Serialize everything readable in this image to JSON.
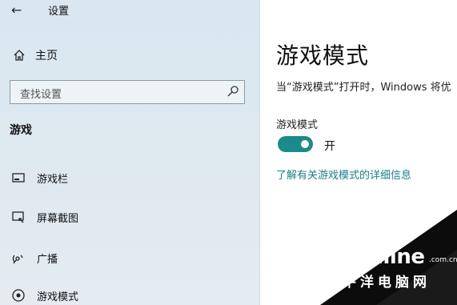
{
  "window": {
    "title": "设置"
  },
  "sidebar": {
    "home_label": "主页",
    "search_placeholder": "查找设置",
    "section_title": "游戏",
    "items": [
      {
        "label": "游戏栏",
        "icon": "game-bar-icon"
      },
      {
        "label": "屏幕截图",
        "icon": "screenshot-icon"
      },
      {
        "label": "广播",
        "icon": "broadcast-icon"
      },
      {
        "label": "游戏模式",
        "icon": "game-mode-icon"
      }
    ]
  },
  "main": {
    "title": "游戏模式",
    "description": "当“游戏模式”打开时，Windows 将优",
    "setting_label": "游戏模式",
    "toggle_state_label": "开",
    "toggle_on": true,
    "link_text": "了解有关游戏模式的详细信息"
  },
  "watermark": {
    "brand": "PConline",
    "domain": ".com.cn",
    "cn_name": "太平洋电脑网"
  },
  "colors": {
    "accent": "#1b8a8a",
    "link": "#1b7f86",
    "sidebar_bg": "#dde8ef"
  }
}
